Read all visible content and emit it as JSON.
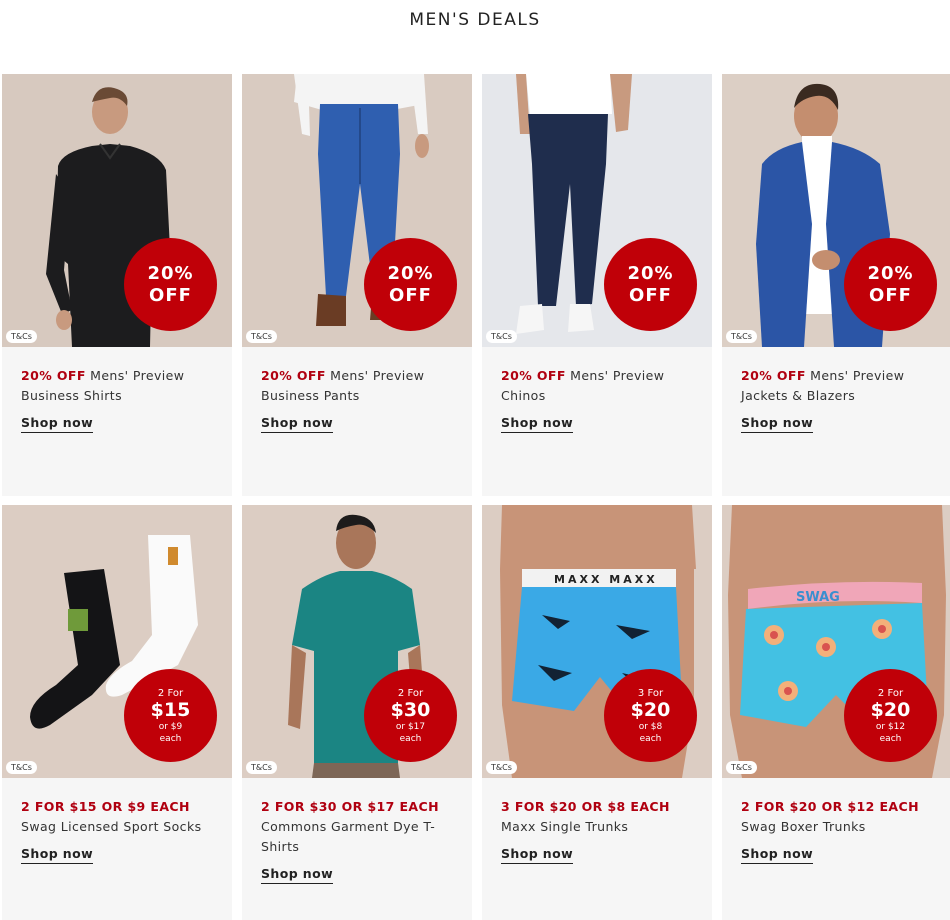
{
  "page": {
    "title": "MEN'S DEALS"
  },
  "colors": {
    "accent": "#c00008",
    "deal_text": "#b00010",
    "card_bg": "#f6f6f6"
  },
  "tcs_label": "T&Cs",
  "products": [
    {
      "badge": {
        "line1": "20%",
        "line2": "OFF"
      },
      "deal": "20% OFF",
      "name": " Mens' Preview Business Shirts",
      "cta": "Shop now",
      "image": "man-black-shirt-photo"
    },
    {
      "badge": {
        "line1": "20%",
        "line2": "OFF"
      },
      "deal": "20% OFF",
      "name": " Mens' Preview Business Pants",
      "cta": "Shop now",
      "image": "blue-business-pants-photo"
    },
    {
      "badge": {
        "line1": "20%",
        "line2": "OFF"
      },
      "deal": "20% OFF",
      "name": " Mens' Preview Chinos",
      "cta": "Shop now",
      "image": "navy-chinos-photo"
    },
    {
      "badge": {
        "line1": "20%",
        "line2": "OFF"
      },
      "deal": "20% OFF",
      "name": " Mens' Preview Jackets & Blazers",
      "cta": "Shop now",
      "image": "blue-blazer-photo"
    },
    {
      "badge": {
        "top": "2 For",
        "price": "$15",
        "bottom1": "or $9",
        "bottom2": "each"
      },
      "deal": "2 FOR $15 OR $9 EACH",
      "name": " Swag Licensed Sport Socks",
      "cta": "Shop now",
      "image": "sport-socks-photo"
    },
    {
      "badge": {
        "top": "2 For",
        "price": "$30",
        "bottom1": "or $17",
        "bottom2": "each"
      },
      "deal": "2 FOR $30 OR $17 EACH",
      "name": " Commons Garment Dye T-Shirts",
      "cta": "Shop now",
      "image": "teal-tshirt-photo"
    },
    {
      "badge": {
        "top": "3 For",
        "price": "$20",
        "bottom1": "or $8",
        "bottom2": "each"
      },
      "deal": "3 FOR $20 OR $8 EACH",
      "name": " Maxx Single Trunks",
      "cta": "Shop now",
      "image": "maxx-trunks-photo",
      "waistband": "MAXX MAXX"
    },
    {
      "badge": {
        "top": "2 For",
        "price": "$20",
        "bottom1": "or $12",
        "bottom2": "each"
      },
      "deal": "2 FOR $20 OR $12 EACH",
      "name": " Swag Boxer Trunks",
      "cta": "Shop now",
      "image": "swag-boxer-trunks-photo",
      "waistband": "SWAG"
    }
  ]
}
